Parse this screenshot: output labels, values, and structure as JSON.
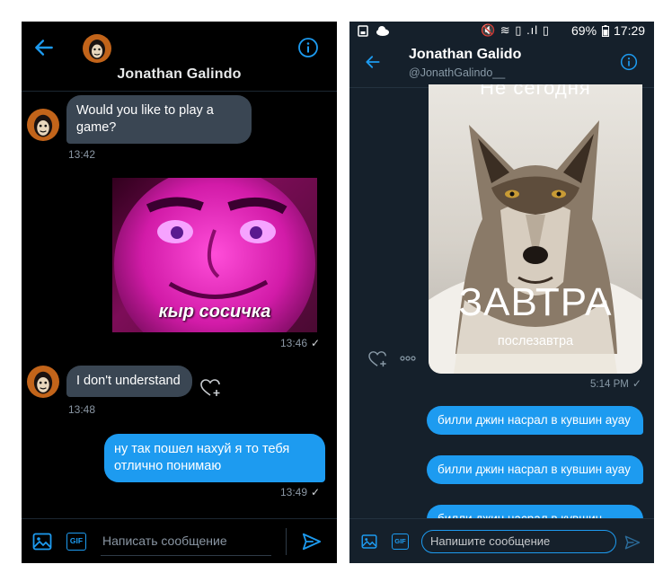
{
  "colors": {
    "accent": "#1d9bf0",
    "left_bg": "#000000",
    "right_bg": "#15202b"
  },
  "left": {
    "header": {
      "name": "Jonathan Galindo",
      "back_icon": "arrow-left-icon",
      "info_icon": "info-icon"
    },
    "messages": [
      {
        "text": "Would you like to play a game?",
        "time": "13:42",
        "direction": "in"
      },
      {
        "image_caption": "кыр сосичка",
        "time": "13:46",
        "direction": "out"
      },
      {
        "text": "I don't understand",
        "time": "13:48",
        "direction": "in"
      },
      {
        "text": "ну так пошел нахуй я то тебя отлично понимаю",
        "time": "13:49",
        "direction": "out"
      }
    ],
    "like_icon": "heart-plus-icon",
    "composer": {
      "placeholder": "Написать сообщение",
      "gif_label": "GIF",
      "image_icon": "image-icon",
      "send_icon": "send-icon"
    }
  },
  "right": {
    "status": {
      "battery": "69%",
      "time": "17:29"
    },
    "header": {
      "name": "Jonathan Galido",
      "handle": "@JonathGalindo__",
      "back_icon": "arrow-left-icon",
      "info_icon": "info-icon"
    },
    "image_message": {
      "top_text": "Не сегодня",
      "big_text": "ЗАВТРА",
      "small_text": "послезавтра",
      "time": "5:14 PM"
    },
    "actions": {
      "like_icon": "heart-plus-icon",
      "more_icon": "more-icon"
    },
    "messages": [
      {
        "text": "билли джин насрал в кувшин ауау"
      },
      {
        "text": "билли джин насрал в кувшин ауау"
      },
      {
        "text": "билли джин насрал в кувшин"
      }
    ],
    "composer": {
      "placeholder": "Напишите сообщение",
      "gif_label": "GIF",
      "image_icon": "image-icon",
      "send_icon": "send-icon"
    }
  }
}
